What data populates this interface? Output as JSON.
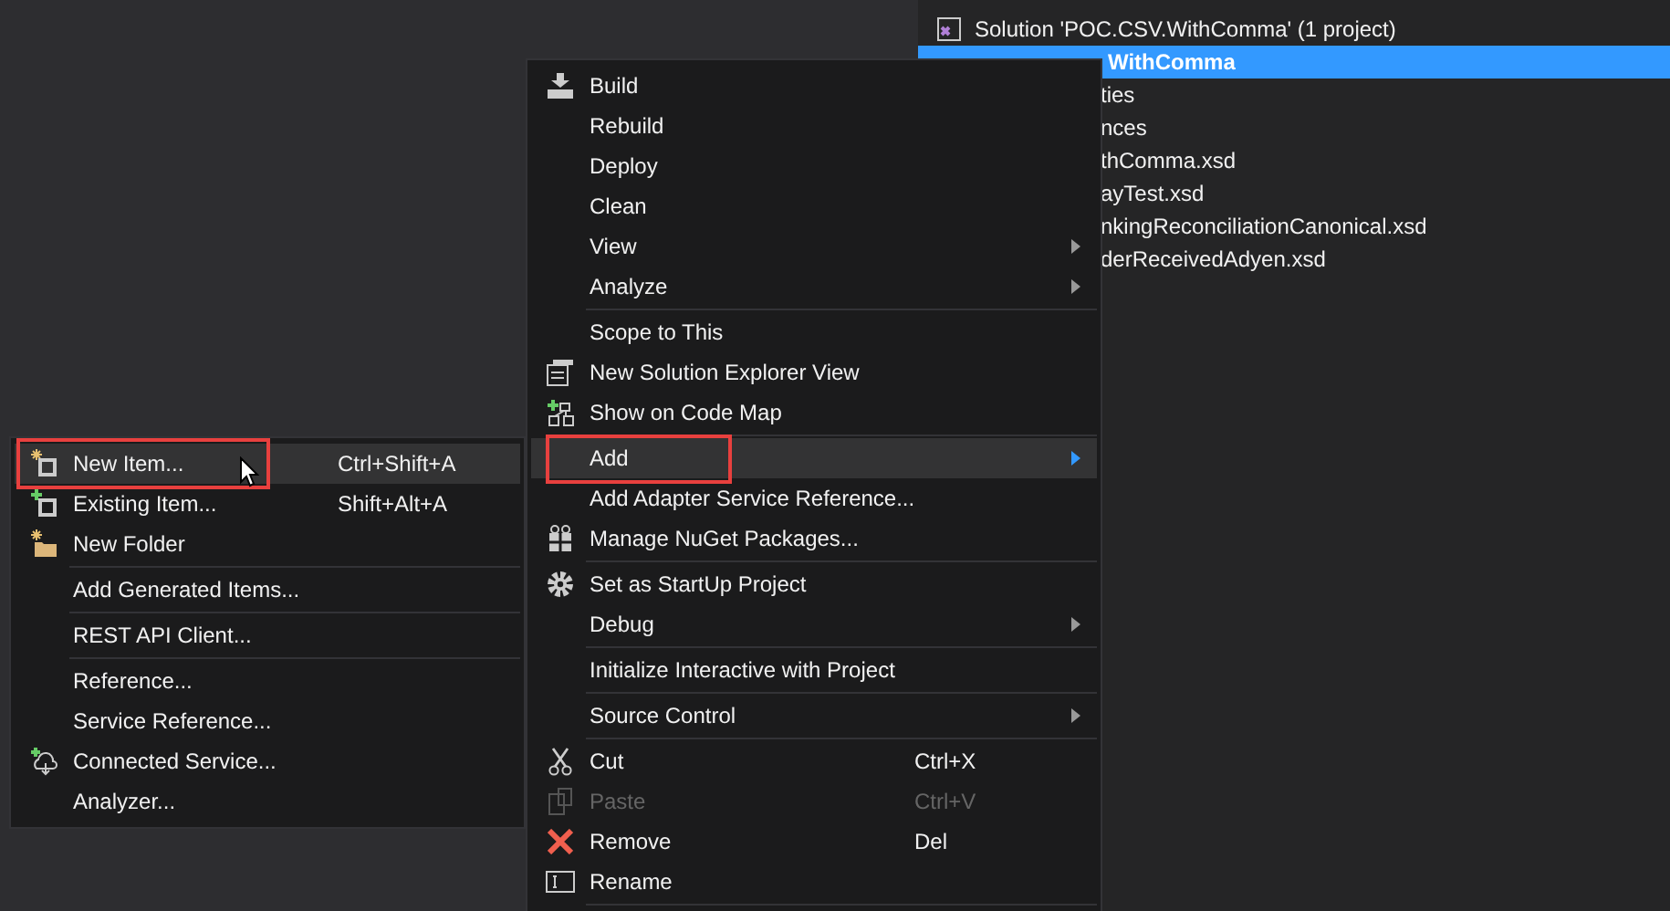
{
  "solution_explorer": {
    "rows": [
      {
        "label": "Solution 'POC.CSV.WithComma' (1 project)",
        "selected": false
      },
      {
        "label": "WithComma",
        "selected": true
      },
      {
        "label": "ties",
        "selected": false
      },
      {
        "label": "nces",
        "selected": false
      },
      {
        "label": "thComma.xsd",
        "selected": false
      },
      {
        "label": "ayTest.xsd",
        "selected": false
      },
      {
        "label": "nkingReconciliationCanonical.xsd",
        "selected": false
      },
      {
        "label": "derReceivedAdyen.xsd",
        "selected": false
      }
    ]
  },
  "context_menu": {
    "items": [
      {
        "kind": "item",
        "label": "Build",
        "submenu": false,
        "disabled": false,
        "selected": false,
        "highlighted": false
      },
      {
        "kind": "item",
        "label": "Rebuild",
        "submenu": false,
        "disabled": false,
        "selected": false,
        "highlighted": false
      },
      {
        "kind": "item",
        "label": "Deploy",
        "submenu": false,
        "disabled": false,
        "selected": false,
        "highlighted": false
      },
      {
        "kind": "item",
        "label": "Clean",
        "submenu": false,
        "disabled": false,
        "selected": false,
        "highlighted": false
      },
      {
        "kind": "item",
        "label": "View",
        "submenu": true,
        "disabled": false,
        "selected": false,
        "highlighted": false
      },
      {
        "kind": "item",
        "label": "Analyze",
        "submenu": true,
        "disabled": false,
        "selected": false,
        "highlighted": false
      },
      {
        "kind": "separator"
      },
      {
        "kind": "item",
        "label": "Scope to This",
        "submenu": false,
        "disabled": false,
        "selected": false,
        "highlighted": false
      },
      {
        "kind": "item",
        "label": "New Solution Explorer View",
        "submenu": false,
        "disabled": false,
        "selected": false,
        "highlighted": false
      },
      {
        "kind": "item",
        "label": "Show on Code Map",
        "submenu": false,
        "disabled": false,
        "selected": false,
        "highlighted": false
      },
      {
        "kind": "separator"
      },
      {
        "kind": "item",
        "label": "Add",
        "submenu": true,
        "disabled": false,
        "selected": true,
        "highlighted": true
      },
      {
        "kind": "item",
        "label": "Add Adapter Service Reference...",
        "submenu": false,
        "disabled": false,
        "selected": false,
        "highlighted": false
      },
      {
        "kind": "item",
        "label": "Manage NuGet Packages...",
        "submenu": false,
        "disabled": false,
        "selected": false,
        "highlighted": false
      },
      {
        "kind": "separator"
      },
      {
        "kind": "item",
        "label": "Set as StartUp Project",
        "submenu": false,
        "disabled": false,
        "selected": false,
        "highlighted": false
      },
      {
        "kind": "item",
        "label": "Debug",
        "submenu": true,
        "disabled": false,
        "selected": false,
        "highlighted": false
      },
      {
        "kind": "separator"
      },
      {
        "kind": "item",
        "label": "Initialize Interactive with Project",
        "submenu": false,
        "disabled": false,
        "selected": false,
        "highlighted": false
      },
      {
        "kind": "separator"
      },
      {
        "kind": "item",
        "label": "Source Control",
        "submenu": true,
        "disabled": false,
        "selected": false,
        "highlighted": false
      },
      {
        "kind": "separator"
      },
      {
        "kind": "item",
        "label": "Cut",
        "shortcut": "Ctrl+X",
        "submenu": false,
        "disabled": false,
        "selected": false,
        "highlighted": false
      },
      {
        "kind": "item",
        "label": "Paste",
        "shortcut": "Ctrl+V",
        "submenu": false,
        "disabled": true,
        "selected": false,
        "highlighted": false
      },
      {
        "kind": "item",
        "label": "Remove",
        "shortcut": "Del",
        "submenu": false,
        "disabled": false,
        "selected": false,
        "highlighted": false
      },
      {
        "kind": "item",
        "label": "Rename",
        "submenu": false,
        "disabled": false,
        "selected": false,
        "highlighted": false
      },
      {
        "kind": "separator"
      }
    ]
  },
  "add_submenu": {
    "items": [
      {
        "kind": "item",
        "label": "New Item...",
        "shortcut": "Ctrl+Shift+A",
        "submenu": false,
        "disabled": false,
        "selected": true,
        "highlighted": true
      },
      {
        "kind": "item",
        "label": "Existing Item...",
        "shortcut": "Shift+Alt+A",
        "submenu": false,
        "disabled": false,
        "selected": false,
        "highlighted": false
      },
      {
        "kind": "item",
        "label": "New Folder",
        "submenu": false,
        "disabled": false,
        "selected": false,
        "highlighted": false
      },
      {
        "kind": "separator"
      },
      {
        "kind": "item",
        "label": "Add Generated Items...",
        "submenu": false,
        "disabled": false,
        "selected": false,
        "highlighted": false
      },
      {
        "kind": "separator"
      },
      {
        "kind": "item",
        "label": "REST API Client...",
        "submenu": false,
        "disabled": false,
        "selected": false,
        "highlighted": false
      },
      {
        "kind": "separator"
      },
      {
        "kind": "item",
        "label": "Reference...",
        "submenu": false,
        "disabled": false,
        "selected": false,
        "highlighted": false
      },
      {
        "kind": "item",
        "label": "Service Reference...",
        "submenu": false,
        "disabled": false,
        "selected": false,
        "highlighted": false
      },
      {
        "kind": "item",
        "label": "Connected Service...",
        "submenu": false,
        "disabled": false,
        "selected": false,
        "highlighted": false
      },
      {
        "kind": "item",
        "label": "Analyzer...",
        "submenu": false,
        "disabled": false,
        "selected": false,
        "highlighted": false
      }
    ]
  }
}
